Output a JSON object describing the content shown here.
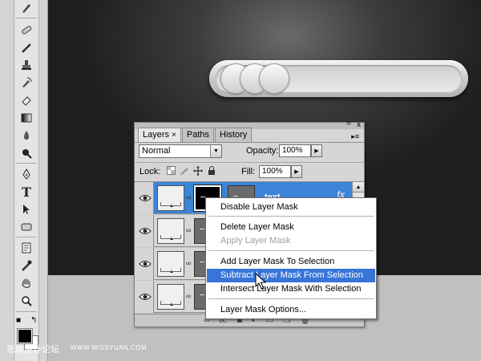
{
  "layers_panel": {
    "tabs": [
      {
        "label": "Layers",
        "close": "×"
      },
      {
        "label": "Paths"
      },
      {
        "label": "History"
      }
    ],
    "close_glyph": "x",
    "minimize_glyph": "=",
    "menu_glyph": "▸≡",
    "blend_mode": "Normal",
    "opacity_label": "Opacity:",
    "opacity_value": "100%",
    "lock_label": "Lock:",
    "fill_label": "Fill:",
    "fill_value": "100%",
    "layers": [
      {
        "name": "text",
        "selected": true,
        "fx": "fx"
      },
      {
        "name": "",
        "selected": false
      },
      {
        "name": "",
        "selected": false
      },
      {
        "name": "",
        "selected": false
      }
    ],
    "bottom_icons": [
      "link-layers-icon",
      "fx-icon",
      "add-mask-icon",
      "adjustment-icon",
      "group-icon",
      "new-layer-icon",
      "delete-icon"
    ],
    "bottom_labels": {
      "fx": "fx."
    }
  },
  "context_menu": {
    "items": [
      {
        "label": "Disable Layer Mask",
        "enabled": true,
        "highlight": false
      },
      {
        "label": "Delete Layer Mask",
        "enabled": true,
        "highlight": false
      },
      {
        "label": "Apply Layer Mask",
        "enabled": false,
        "highlight": false
      },
      {
        "label": "Add Layer Mask To Selection",
        "enabled": true,
        "highlight": false
      },
      {
        "label": "Subtract Layer Mask From Selection",
        "enabled": true,
        "highlight": true
      },
      {
        "label": "Intersect Layer Mask With Selection",
        "enabled": true,
        "highlight": false
      },
      {
        "label": "Layer Mask Options...",
        "enabled": true,
        "highlight": false
      }
    ]
  },
  "tools": {
    "icons": [
      "brush-tool-icon",
      "healing-brush-icon",
      "pencil-icon",
      "clone-stamp-icon",
      "history-brush-icon",
      "eraser-icon",
      "gradient-icon",
      "blur-icon",
      "dodge-icon",
      "pen-tool-icon",
      "type-tool-icon",
      "path-selection-icon",
      "shape-tool-icon",
      "notes-icon",
      "eyedropper-icon",
      "hand-tool-icon",
      "zoom-tool-icon"
    ],
    "type_glyph": "T"
  },
  "colors": {
    "foreground": "#000000",
    "background": "#ffffff",
    "selection_blue": "#3c84d8",
    "menu_highlight": "#3875d7"
  },
  "watermark": {
    "left": "思缘设计论坛",
    "right": "WWW.MISSYUAN.COM"
  }
}
